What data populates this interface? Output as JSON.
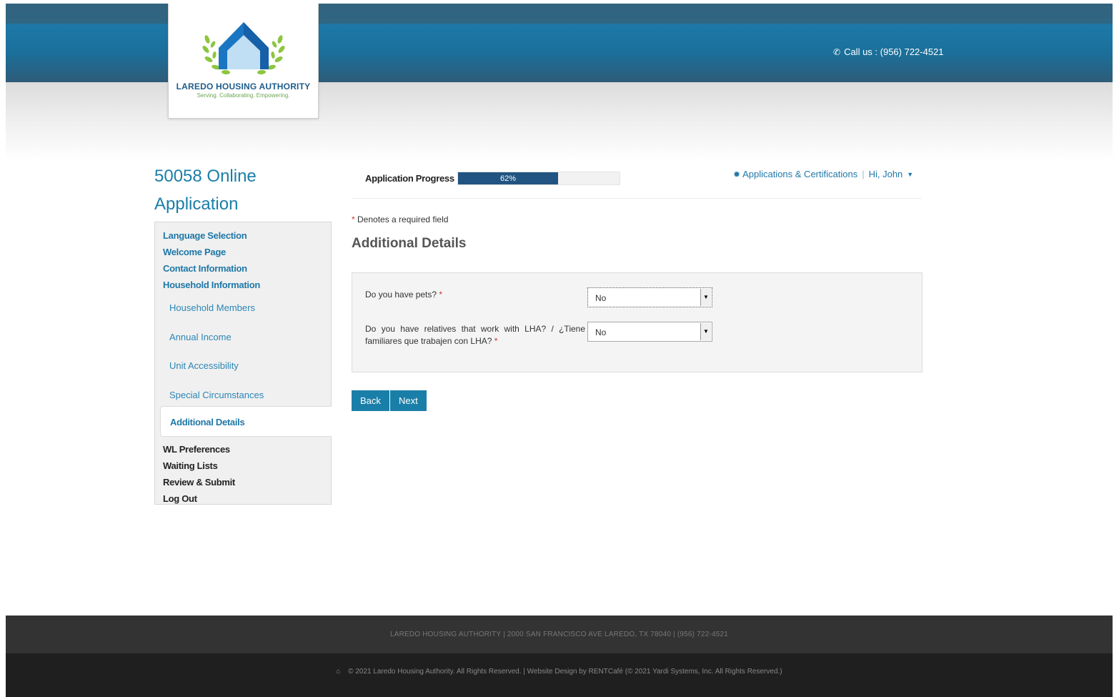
{
  "header": {
    "org_name": "LAREDO HOUSING AUTHORITY",
    "tagline": "Serving. Collaborating. Empowering.",
    "call_us": "Call us : (956) 722-4521",
    "icons": {
      "phone": "phone-icon"
    }
  },
  "sidebar": {
    "title": "50058 Online Application",
    "top_items": [
      "Language Selection",
      "Welcome Page",
      "Contact Information",
      "Household Information"
    ],
    "sub_items": [
      "Household Members",
      "Annual Income",
      "Unit Accessibility",
      "Special Circumstances"
    ],
    "active_item": "Additional Details",
    "bottom_items": [
      "WL Preferences",
      "Waiting Lists",
      "Review & Submit",
      "Log Out"
    ]
  },
  "progress": {
    "label": "Application Progress",
    "percent_text": "62%",
    "percent": 62
  },
  "top_nav": {
    "applications_link": "Applications & Certifications",
    "user_menu": "Hi, John"
  },
  "form": {
    "required_note": "Denotes a required field",
    "required_mark": "*",
    "section_title": "Additional Details",
    "questions": [
      {
        "label": "Do you have pets?",
        "value": "No"
      },
      {
        "label": "Do you have relatives that work with LHA? / ¿Tiene familiares que trabajen con LHA?",
        "value": "No"
      }
    ],
    "back_label": "Back",
    "next_label": "Next"
  },
  "footer": {
    "info": "LAREDO HOUSING AUTHORITY   |   2000 SAN FRANCISCO AVE LAREDO, TX 78040   |   (956) 722-4521",
    "copyright": "© 2021 Laredo Housing Authority. All Rights Reserved. | Website Design by RENTCafé (© 2021 Yardi Systems, Inc. All Rights Reserved.)"
  },
  "colors": {
    "brand_blue": "#1a7ea8",
    "progress_fill": "#215481",
    "header_blue": "#1d79a8",
    "required_red": "#cc3333"
  }
}
